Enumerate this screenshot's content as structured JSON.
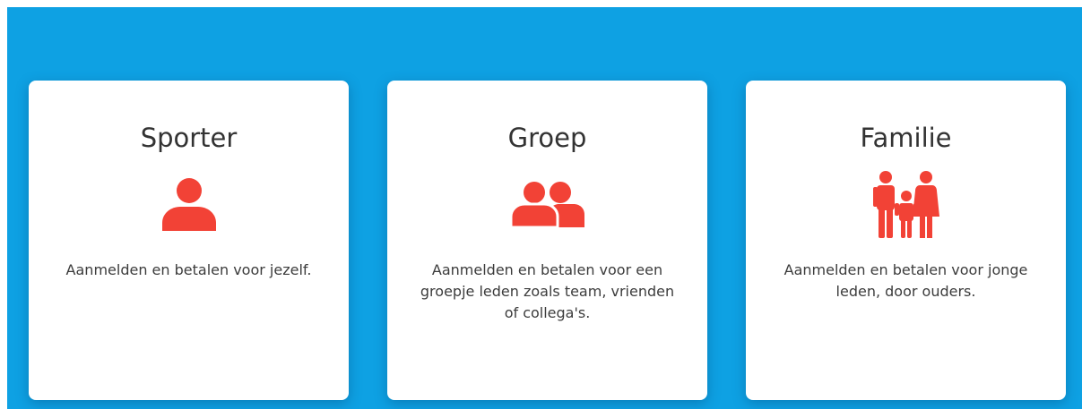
{
  "colors": {
    "background": "#0ea1e3",
    "card": "#ffffff",
    "accent": "#f24236",
    "title": "#333333",
    "text": "#3c3c3c"
  },
  "cards": [
    {
      "title": "Sporter",
      "icon": "person-icon",
      "description": "Aanmelden en betalen voor jezelf."
    },
    {
      "title": "Groep",
      "icon": "group-icon",
      "description": "Aanmelden en betalen voor een groepje leden zoals team, vrienden of collega's."
    },
    {
      "title": "Familie",
      "icon": "family-icon",
      "description": "Aanmelden en betalen voor jonge leden, door ouders."
    }
  ]
}
